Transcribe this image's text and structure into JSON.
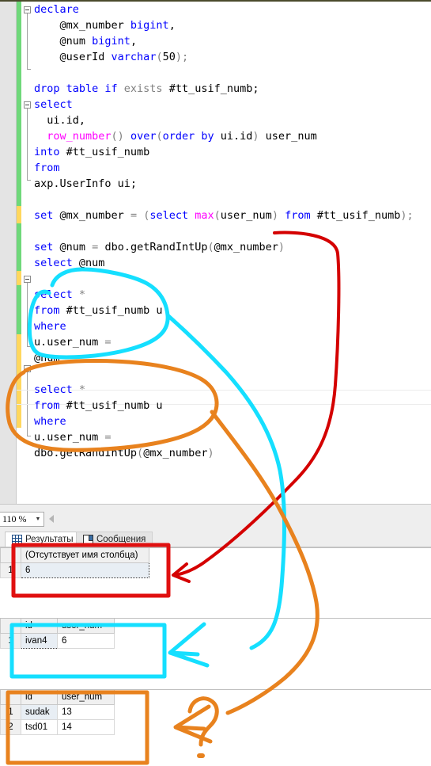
{
  "editor": {
    "zoom_level": "110 %",
    "lines": [
      {
        "indent": 0,
        "fold": true,
        "tokens": [
          {
            "t": "declare",
            "c": "kw"
          }
        ]
      },
      {
        "indent": 0,
        "fold": false,
        "tokens": [
          {
            "t": "    @mx_number ",
            "c": "plain"
          },
          {
            "t": "bigint",
            "c": "kw"
          },
          {
            "t": ",",
            "c": "plain"
          }
        ]
      },
      {
        "indent": 0,
        "fold": false,
        "tokens": [
          {
            "t": "    @num ",
            "c": "plain"
          },
          {
            "t": "bigint",
            "c": "kw"
          },
          {
            "t": ",",
            "c": "plain"
          }
        ]
      },
      {
        "indent": 0,
        "fold": false,
        "tokens": [
          {
            "t": "    @userId ",
            "c": "plain"
          },
          {
            "t": "varchar",
            "c": "kw"
          },
          {
            "t": "(",
            "c": "gray"
          },
          {
            "t": "50",
            "c": "plain"
          },
          {
            "t": ");",
            "c": "gray"
          }
        ]
      },
      {
        "indent": 0,
        "fold": false,
        "tokens": []
      },
      {
        "indent": 0,
        "fold": false,
        "tokens": [
          {
            "t": "drop table if ",
            "c": "kw"
          },
          {
            "t": "exists ",
            "c": "gray"
          },
          {
            "t": "#tt_usif_numb;",
            "c": "plain"
          }
        ]
      },
      {
        "indent": 0,
        "fold": true,
        "tokens": [
          {
            "t": "select",
            "c": "kw"
          }
        ]
      },
      {
        "indent": 0,
        "fold": false,
        "tokens": [
          {
            "t": "  ui.id,",
            "c": "plain"
          }
        ]
      },
      {
        "indent": 0,
        "fold": false,
        "tokens": [
          {
            "t": "  ",
            "c": "plain"
          },
          {
            "t": "row_number",
            "c": "fn"
          },
          {
            "t": "() ",
            "c": "gray"
          },
          {
            "t": "over",
            "c": "kw"
          },
          {
            "t": "(",
            "c": "gray"
          },
          {
            "t": "order by",
            "c": "kw"
          },
          {
            "t": " ui.id",
            "c": "plain"
          },
          {
            "t": ")",
            "c": "gray"
          },
          {
            "t": " user_num",
            "c": "plain"
          }
        ]
      },
      {
        "indent": 0,
        "fold": false,
        "tokens": [
          {
            "t": "into",
            "c": "kw"
          },
          {
            "t": " #tt_usif_numb",
            "c": "plain"
          }
        ]
      },
      {
        "indent": 0,
        "fold": false,
        "tokens": [
          {
            "t": "from",
            "c": "kw"
          }
        ]
      },
      {
        "indent": 0,
        "fold": false,
        "tokens": [
          {
            "t": "axp.UserInfo ui;",
            "c": "plain"
          }
        ]
      },
      {
        "indent": 0,
        "fold": false,
        "tokens": []
      },
      {
        "indent": 0,
        "fold": false,
        "tokens": [
          {
            "t": "set",
            "c": "kw"
          },
          {
            "t": " @mx_number ",
            "c": "plain"
          },
          {
            "t": "=",
            "c": "gray"
          },
          {
            "t": " (",
            "c": "gray"
          },
          {
            "t": "select ",
            "c": "kw"
          },
          {
            "t": "max",
            "c": "fn"
          },
          {
            "t": "(",
            "c": "gray"
          },
          {
            "t": "user_num",
            "c": "plain"
          },
          {
            "t": ") ",
            "c": "gray"
          },
          {
            "t": "from",
            "c": "kw"
          },
          {
            "t": " #tt_usif_numb",
            "c": "plain"
          },
          {
            "t": ");",
            "c": "gray"
          }
        ]
      },
      {
        "indent": 0,
        "fold": false,
        "tokens": []
      },
      {
        "indent": 0,
        "fold": false,
        "tokens": [
          {
            "t": "set",
            "c": "kw"
          },
          {
            "t": " @num ",
            "c": "plain"
          },
          {
            "t": "=",
            "c": "gray"
          },
          {
            "t": " dbo.getRandIntUp",
            "c": "plain"
          },
          {
            "t": "(",
            "c": "gray"
          },
          {
            "t": "@mx_number",
            "c": "plain"
          },
          {
            "t": ")",
            "c": "gray"
          }
        ]
      },
      {
        "indent": 0,
        "fold": false,
        "tokens": [
          {
            "t": "select",
            "c": "kw"
          },
          {
            "t": " @num",
            "c": "plain"
          }
        ]
      },
      {
        "indent": 0,
        "fold": false,
        "tokens": []
      },
      {
        "indent": 0,
        "fold": true,
        "tokens": [
          {
            "t": "select",
            "c": "kw"
          },
          {
            "t": " *",
            "c": "gray"
          }
        ]
      },
      {
        "indent": 0,
        "fold": false,
        "tokens": [
          {
            "t": "from",
            "c": "kw"
          },
          {
            "t": " #tt_usif_numb u",
            "c": "plain"
          }
        ]
      },
      {
        "indent": 0,
        "fold": false,
        "tokens": [
          {
            "t": "where",
            "c": "kw"
          }
        ]
      },
      {
        "indent": 0,
        "fold": false,
        "tokens": [
          {
            "t": "u.user_num ",
            "c": "plain"
          },
          {
            "t": "=",
            "c": "gray"
          }
        ]
      },
      {
        "indent": 0,
        "fold": false,
        "tokens": [
          {
            "t": "@num",
            "c": "plain"
          }
        ]
      },
      {
        "indent": 0,
        "fold": false,
        "tokens": []
      },
      {
        "indent": 0,
        "fold": true,
        "tokens": [
          {
            "t": "select",
            "c": "kw"
          },
          {
            "t": " *",
            "c": "gray"
          }
        ]
      },
      {
        "indent": 0,
        "fold": false,
        "tokens": [
          {
            "t": "from",
            "c": "kw"
          },
          {
            "t": " #tt_usif_numb u",
            "c": "plain"
          }
        ]
      },
      {
        "indent": 0,
        "fold": false,
        "tokens": [
          {
            "t": "where",
            "c": "kw"
          }
        ]
      },
      {
        "indent": 0,
        "fold": false,
        "tokens": [
          {
            "t": "u.user_num ",
            "c": "plain"
          },
          {
            "t": "=",
            "c": "gray"
          }
        ]
      },
      {
        "indent": 0,
        "fold": false,
        "tokens": [
          {
            "t": "dbo.getRandIntUp",
            "c": "plain"
          },
          {
            "t": "(",
            "c": "gray"
          },
          {
            "t": "@mx_number",
            "c": "plain"
          },
          {
            "t": ")",
            "c": "gray"
          }
        ]
      }
    ]
  },
  "results": {
    "tabs": [
      {
        "label": "Результаты",
        "icon": "results-grid-icon",
        "active": true
      },
      {
        "label": "Сообщения",
        "icon": "messages-icon",
        "active": false
      }
    ],
    "grids": [
      {
        "name": "scalar-result-grid",
        "columns": [
          "(Отсутствует имя столбца)"
        ],
        "rows": [
          {
            "num": "1",
            "cells": [
              "6"
            ]
          }
        ]
      },
      {
        "name": "single-user-result-grid",
        "columns": [
          "id",
          "user_num"
        ],
        "rows": [
          {
            "num": "1",
            "cells": [
              "ivan4",
              "6"
            ]
          }
        ]
      },
      {
        "name": "multi-user-result-grid",
        "columns": [
          "id",
          "user_num"
        ],
        "rows": [
          {
            "num": "1",
            "cells": [
              "sudak",
              "13"
            ]
          },
          {
            "num": "2",
            "cells": [
              "tsd01",
              "14"
            ]
          }
        ]
      }
    ]
  },
  "annotations": {
    "colors": {
      "red": "#d40000",
      "cyan": "#15dfff",
      "orange": "#e8821e"
    },
    "items": [
      {
        "name": "red-callout",
        "color": "red",
        "note": "links 'set @num = dbo.getRandIntUp(@mx_number)' line to the scalar result grid showing 6"
      },
      {
        "name": "cyan-callout",
        "color": "cyan",
        "note": "circles the first 'select * from #tt_usif_numb u where u.user_num = @num' block and links it to the ivan4 / 6 result grid"
      },
      {
        "name": "orange-callout",
        "color": "orange",
        "note": "circles the second 'select * ... where u.user_num = dbo.getRandIntUp(@mx_number)' block and links it to the sudak/tsd01 result grid, ending in a question mark"
      },
      {
        "name": "question-mark",
        "color": "orange",
        "note": "hand drawn '?' at bottom right"
      }
    ]
  }
}
